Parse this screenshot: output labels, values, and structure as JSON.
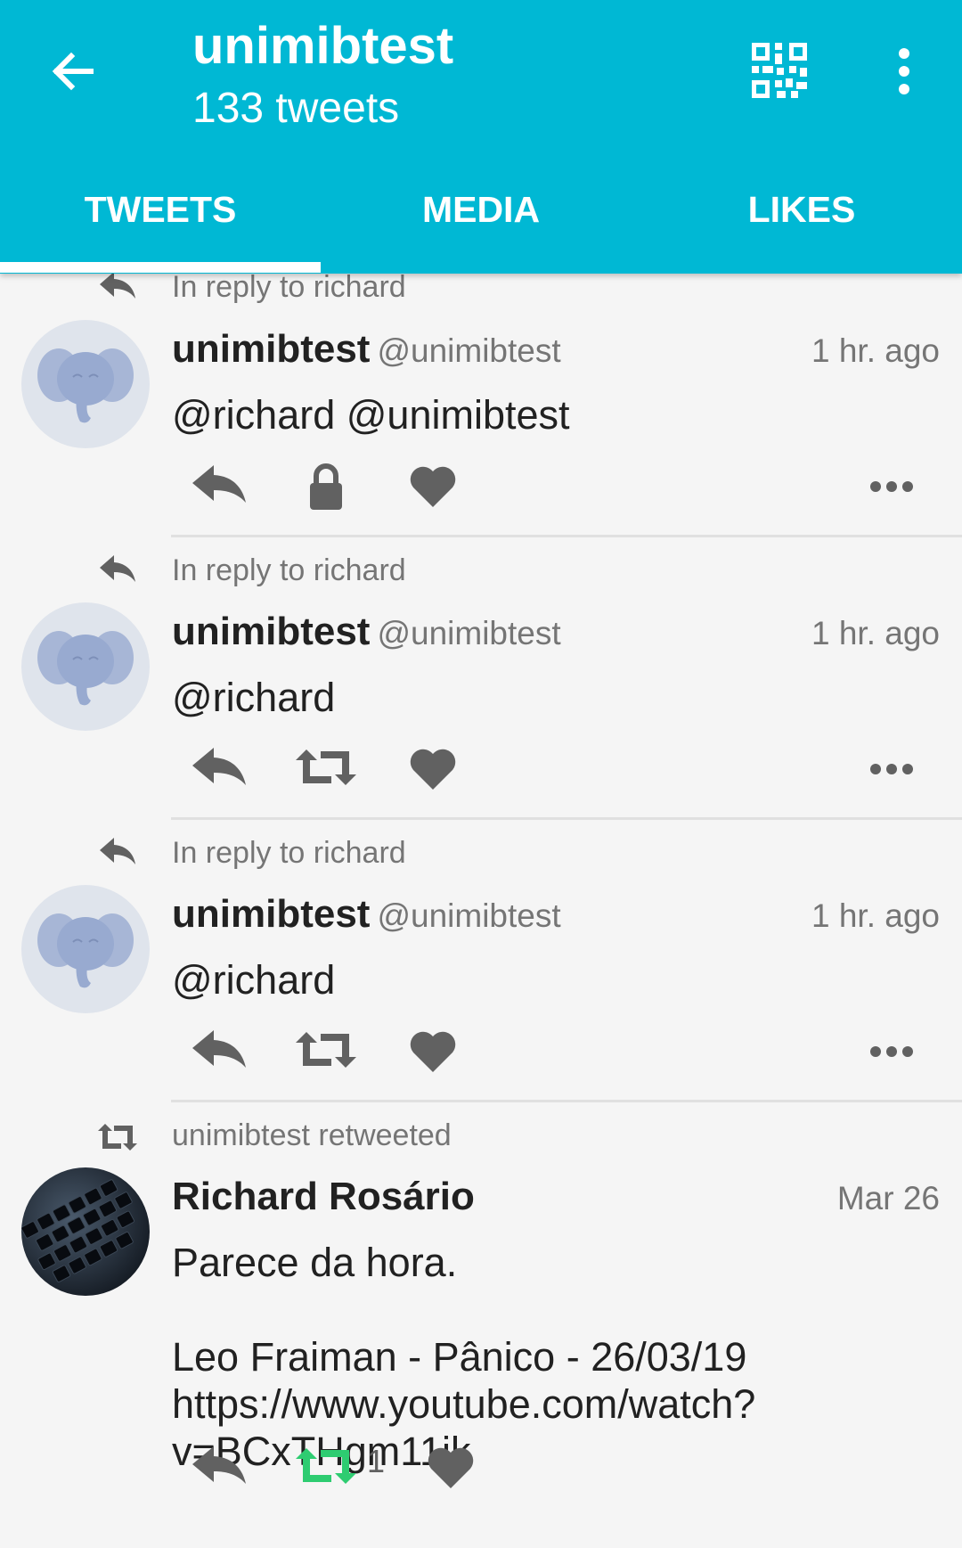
{
  "header": {
    "title": "unimibtest",
    "subtitle": "133 tweets",
    "back_icon": "arrow-left-icon",
    "qr_icon": "qr-code-icon",
    "more_icon": "more-vertical-icon",
    "background": "#00b8d4"
  },
  "tabs": [
    {
      "label": "TWEETS",
      "active": true
    },
    {
      "label": "MEDIA",
      "active": false
    },
    {
      "label": "LIKES",
      "active": false
    }
  ],
  "tweets": [
    {
      "context": "In reply to richard",
      "name": "unimibtest",
      "handle": "@unimibtest",
      "time": "1 hr. ago",
      "text": "@richard @unimibtest",
      "locked": true
    },
    {
      "context": "In reply to richard",
      "name": "unimibtest",
      "handle": "@unimibtest",
      "time": "1 hr. ago",
      "text": "@richard",
      "locked": false
    },
    {
      "context": "In reply to richard",
      "name": "unimibtest",
      "handle": "@unimibtest",
      "time": "1 hr. ago",
      "text": "@richard",
      "locked": false
    },
    {
      "context": "unimibtest retweeted",
      "name": "Richard Rosário",
      "handle": "",
      "time": "Mar 26",
      "text": "Parece da hora.\n\nLeo Fraiman - Pânico - 26/03/19\nhttps://www.youtube.com/watch?\nv=BCxTHgm11jk",
      "retweet_count": "1"
    }
  ]
}
